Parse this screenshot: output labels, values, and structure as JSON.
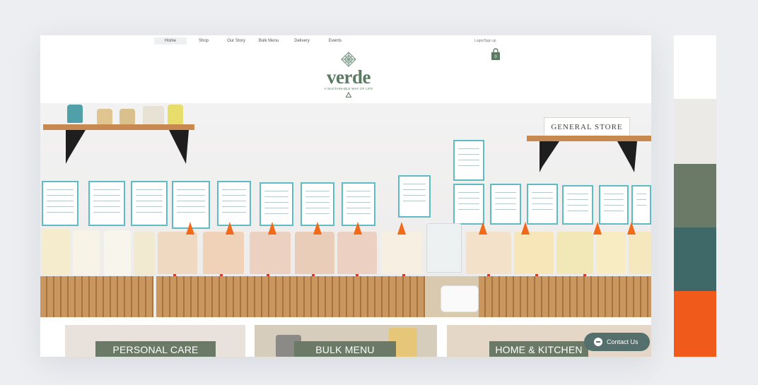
{
  "nav": {
    "items": [
      "Home",
      "Shop",
      "Our Story",
      "Bulk Menu",
      "Delivery",
      "Events"
    ],
    "active": "Home",
    "login": "Login/Sign up"
  },
  "logo": {
    "name": "verde",
    "tagline": "A SUSTAINABLE WAY OF LIFE"
  },
  "hero": {
    "store_sign": "GENERAL STORE"
  },
  "tiles": [
    {
      "label": "PERSONAL CARE"
    },
    {
      "label": "BULK MENU"
    },
    {
      "label": "HOME & KITCHEN"
    }
  ],
  "contact": {
    "label": "Contact Us"
  },
  "palette": {
    "colors": [
      "#ffffff",
      "#eceae7",
      "#6a7a67",
      "#3f6869",
      "#f05a1a"
    ]
  },
  "colors": {
    "brand_green": "#5a7a62",
    "label_teal": "#5fbcc4",
    "orange_cap": "#f06a1a",
    "wood": "#c8894e"
  }
}
